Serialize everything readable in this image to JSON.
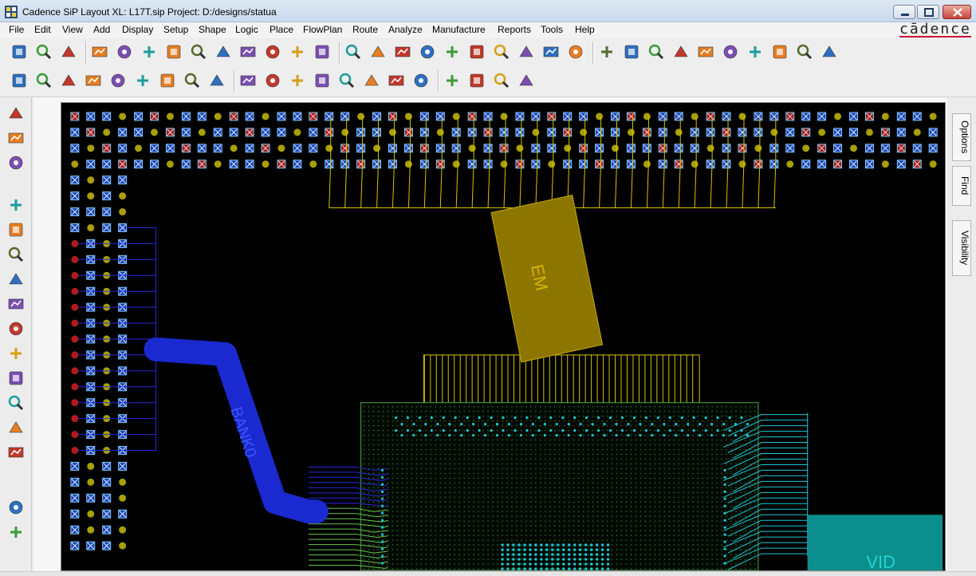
{
  "window": {
    "title": "Cadence SiP Layout XL: L17T.sip  Project: D:/designs/statua"
  },
  "menus": [
    "File",
    "Edit",
    "View",
    "Add",
    "Display",
    "Setup",
    "Shape",
    "Logic",
    "Place",
    "FlowPlan",
    "Route",
    "Analyze",
    "Manufacture",
    "Reports",
    "Tools",
    "Help"
  ],
  "brand": "cādence",
  "side_tabs": [
    "Options",
    "Find",
    "Visibility"
  ],
  "canvas": {
    "component_label": "EM",
    "bank_label": "BANK0",
    "region_label": "VID"
  },
  "toolbar1_icons": [
    "new-icon",
    "open-icon",
    "save-icon",
    "move-icon",
    "copy-icon",
    "mirror-icon",
    "delete-icon",
    "undo-icon",
    "redo-icon",
    "done-icon",
    "oops-icon",
    "pin-icon",
    "push-pin-icon",
    "grid-icon",
    "zoom-fit-icon",
    "zoom-window-icon",
    "zoom-in-icon",
    "zoom-out-icon",
    "zoom-prev-icon",
    "zoom-world-icon",
    "redraw-icon",
    "flip-icon",
    "3d-view-icon",
    "properties-icon",
    "info-icon",
    "report-icon",
    "measure-icon",
    "highlight-icon",
    "light-icon",
    "dehighlight-icon",
    "chart-icon",
    "drc-icon",
    "shape-icon"
  ],
  "toolbar2_icons": [
    "layer1-icon",
    "layer2-icon",
    "layer3-icon",
    "layer4-icon",
    "layer5-icon",
    "layer6-icon",
    "layer7-icon",
    "layer8-icon",
    "layer9-icon",
    "grid-settings-icon",
    "color-icon",
    "palette-icon",
    "stack-icon",
    "ecset-icon",
    "dfa-icon",
    "globe-icon",
    "bridge-icon",
    "route-icon",
    "add-route-icon",
    "edit-route-icon",
    "unroute-icon"
  ],
  "left_tools": [
    "component-icon",
    "symbol-icon",
    "pin-tool-icon",
    "route-tool-icon",
    "fanout-icon",
    "delay-tune-icon",
    "swap-icon",
    "spread-icon",
    "shape-fill-icon",
    "group-icon",
    "layer-stack-icon",
    "die-icon",
    "bondwire-icon",
    "serpentine-icon",
    "line-icon",
    "rectangle-icon"
  ]
}
